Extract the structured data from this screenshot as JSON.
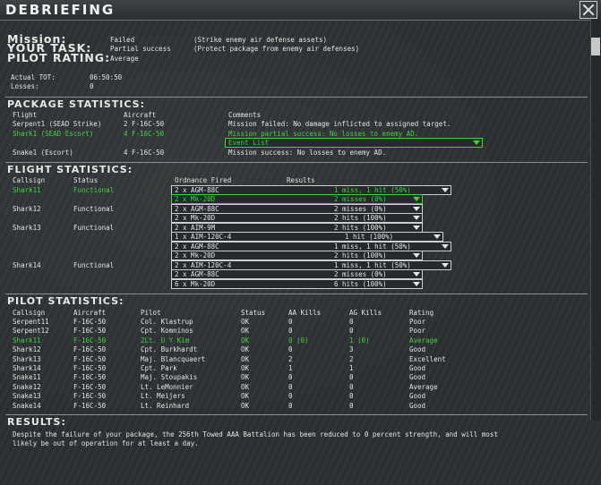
{
  "window": {
    "title": "DEBRIEFING"
  },
  "summary": {
    "mission_label": "Mission:",
    "mission_value": "Failed",
    "mission_desc": "(Strike enemy air defense assets)",
    "task_label": "YOUR TASK:",
    "task_value": "Partial success",
    "task_desc": "(Protect package from enemy air defenses)",
    "rating_label": "PILOT RATING:",
    "rating_value": "Average",
    "tot_label": "Actual TOT:",
    "tot_value": "06:50:50",
    "losses_label": "Losses:",
    "losses_value": "0"
  },
  "package": {
    "header": "PACKAGE STATISTICS:",
    "col_flight": "Flight",
    "col_aircraft": "Aircraft",
    "col_comments": "Comments",
    "rows": [
      {
        "flight": "Serpent1 (SEAD Strike)",
        "aircraft": "2 F-16C-50",
        "comment": "Mission failed: No damage inflicted to assigned target."
      },
      {
        "flight": "Shark1 (SEAD Escort)",
        "aircraft": "4 F-16C-50",
        "comment": "Mission partial success: No losses to enemy AD."
      },
      {
        "flight": "Snake1 (Escort)",
        "aircraft": "4 F-16C-50",
        "comment": "Mission success: No losses to enemy AD."
      }
    ],
    "event_list": "Event List"
  },
  "flight": {
    "header": "FLIGHT STATISTICS:",
    "col_callsign": "Callsign",
    "col_status": "Status",
    "col_ordnance": "Ordnance Fired",
    "col_results": "Results",
    "groups": [
      {
        "callsign": "Shark11",
        "status": "Functional"
      },
      {
        "callsign": "Shark12",
        "status": "Functional"
      },
      {
        "callsign": "Shark13",
        "status": "Functional"
      },
      {
        "callsign": "Shark14",
        "status": "Functional"
      }
    ],
    "ordnance": [
      {
        "weapon": "2 x AGM-88C",
        "result": "1 miss, 1 hit (50%)"
      },
      {
        "weapon": "2 x Mk-20D",
        "result": "2 misses (0%)"
      },
      {
        "weapon": "2 x AGM-88C",
        "result": "2 misses (0%)"
      },
      {
        "weapon": "2 x Mk-20D",
        "result": "2 hits (100%)"
      },
      {
        "weapon": "2 x AIM-9M",
        "result": "2 hits (100%)"
      },
      {
        "weapon": "1 x AIM-120C-4",
        "result": "1 hit (100%)"
      },
      {
        "weapon": "2 x AGM-88C",
        "result": "1 miss, 1 hit (50%)"
      },
      {
        "weapon": "2 x Mk-20D",
        "result": "2 hits (100%)"
      },
      {
        "weapon": "2 x AIM-120C-4",
        "result": "1 miss, 1 hit (50%)"
      },
      {
        "weapon": "2 x AGM-88C",
        "result": "2 misses (0%)"
      },
      {
        "weapon": "6 x Mk-20D",
        "result": "6 hits (100%)"
      }
    ]
  },
  "pilot": {
    "header": "PILOT STATISTICS:",
    "cols": [
      "Callsign",
      "Aircraft",
      "Pilot",
      "Status",
      "AA Kills",
      "AG Kills",
      "Rating"
    ],
    "rows": [
      [
        "Serpent11",
        "F-16C-50",
        "Col. Klastrup",
        "OK",
        "0",
        "0",
        "Poor"
      ],
      [
        "Serpent12",
        "F-16C-50",
        "Cpt. Komninos",
        "OK",
        "0",
        "0",
        "Poor"
      ],
      [
        "Shark11",
        "F-16C-50",
        "2Lt. U Y Kim",
        "OK",
        "0 (0)",
        "1 (0)",
        "Average"
      ],
      [
        "Shark12",
        "F-16C-50",
        "Cpt. Burkhardt",
        "OK",
        "0",
        "3",
        "Good"
      ],
      [
        "Shark13",
        "F-16C-50",
        "Maj. Blancquaert",
        "OK",
        "2",
        "2",
        "Excellent"
      ],
      [
        "Shark14",
        "F-16C-50",
        "Cpt. Park",
        "OK",
        "1",
        "1",
        "Good"
      ],
      [
        "Snake11",
        "F-16C-50",
        "Maj. Stoupakis",
        "OK",
        "0",
        "0",
        "Good"
      ],
      [
        "Snake12",
        "F-16C-50",
        "Lt. LeMonnier",
        "OK",
        "0",
        "0",
        "Average"
      ],
      [
        "Snake13",
        "F-16C-50",
        "Lt. Meijers",
        "OK",
        "0",
        "0",
        "Good"
      ],
      [
        "Snake14",
        "F-16C-50",
        "Lt. Reinhard",
        "OK",
        "0",
        "0",
        "Good"
      ]
    ]
  },
  "results": {
    "header": "RESULTS:",
    "line1": "Despite the failure of your package, the 256th Towed AAA Battalion has been reduced to 0 percent strength, and will most",
    "line2": "likely be out of operation for at least a day."
  },
  "colors": {
    "highlight": "#3fd43f",
    "background": "#2b2f31"
  }
}
